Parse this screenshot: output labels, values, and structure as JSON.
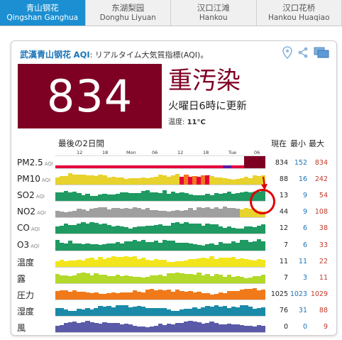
{
  "tabs": [
    {
      "zh": "青山钢花",
      "en": "Qingshan Ganghua",
      "active": true
    },
    {
      "zh": "东湖梨园",
      "en": "Donghu Liyuan",
      "active": false
    },
    {
      "zh": "汉口江滩",
      "en": "Hankou",
      "active": false
    },
    {
      "zh": "汉口花桥",
      "en": "Hankou Huaqiao",
      "active": false
    }
  ],
  "card": {
    "station": "武漢青山钢花",
    "aqi_tag": "AQI",
    "description": ": リアルタイム大気質指標(AQI)。",
    "aqi_value": "834",
    "level": "重汚染",
    "updated": "火曜日6時に更新",
    "temperature_label": "温度:",
    "temperature_value": "11°C",
    "icons": [
      "location-pin-icon",
      "share-icon",
      "screens-icon"
    ]
  },
  "chart": {
    "last_two_days": "最後の2日間",
    "current_label": "現在",
    "min_label": "最小",
    "max_label": "最大",
    "ticks": [
      "12",
      "18",
      "Mon",
      "06",
      "12",
      "18",
      "Tue",
      "06"
    ],
    "aqi_suffix": "AQI"
  },
  "rows": [
    {
      "label": "PM2.5",
      "aqi": true,
      "current": "834",
      "min": "152",
      "max": "834",
      "color": "#e5003d"
    },
    {
      "label": "PM10",
      "aqi": true,
      "current": "88",
      "min": "16",
      "max": "242",
      "color": "#e8d22e"
    },
    {
      "label": "SO2",
      "aqi": true,
      "current": "13",
      "min": "9",
      "max": "54",
      "color": "#1f9a62"
    },
    {
      "label": "NO2",
      "aqi": true,
      "current": "44",
      "min": "9",
      "max": "108",
      "color": "#9f9f9f"
    },
    {
      "label": "CO",
      "aqi": true,
      "current": "12",
      "min": "6",
      "max": "38",
      "color": "#1f9a62"
    },
    {
      "label": "O3",
      "aqi": true,
      "current": "7",
      "min": "6",
      "max": "33",
      "color": "#1f9a62"
    },
    {
      "label": "温度",
      "aqi": false,
      "current": "11",
      "min": "11",
      "max": "22",
      "color": "#f2e51e"
    },
    {
      "label": "露",
      "aqi": false,
      "current": "7",
      "min": "3",
      "max": "11",
      "color": "#b3d92a"
    },
    {
      "label": "圧力",
      "aqi": false,
      "current": "1025",
      "min": "1023",
      "max": "1029",
      "color": "#f07a1a"
    },
    {
      "label": "湿度",
      "aqi": false,
      "current": "76",
      "min": "31",
      "max": "88",
      "color": "#1a8aa8"
    },
    {
      "label": "風",
      "aqi": false,
      "current": "0",
      "min": "0",
      "max": "9",
      "color": "#5a5aa8"
    }
  ]
}
